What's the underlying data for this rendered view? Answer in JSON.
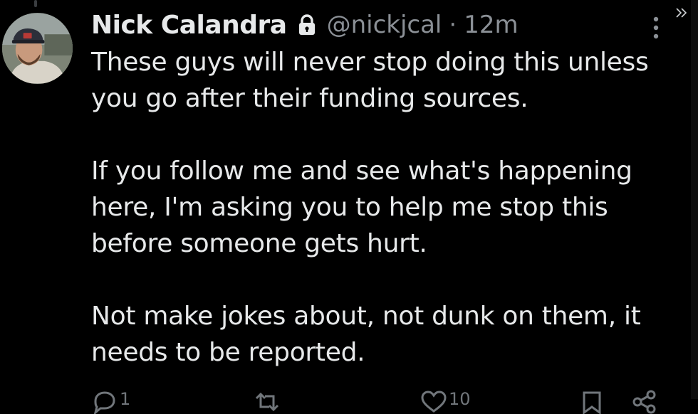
{
  "tweet": {
    "author": {
      "display_name": "Nick Calandra",
      "handle": "@nickjcal",
      "protected_icon": "lock-icon",
      "avatar_icon": "avatar-photo"
    },
    "separator": "·",
    "timestamp": "12m",
    "paragraphs": [
      "These guys will never stop doing this unless you go after their funding sources.",
      "If you follow me and see what's happening here, I'm asking you to help me stop this before someone gets hurt.",
      "Not make jokes about, not dunk on them, it needs to be reported."
    ],
    "actions": {
      "reply": {
        "icon": "reply-icon",
        "count": "1"
      },
      "retweet": {
        "icon": "retweet-icon",
        "count": ""
      },
      "like": {
        "icon": "heart-icon",
        "count": "10"
      },
      "bookmark": {
        "icon": "bookmark-icon",
        "count": ""
      },
      "share": {
        "icon": "share-icon",
        "count": ""
      }
    },
    "menu_icon": "more-options-icon",
    "expand_icon": "double-chevron-right-icon"
  },
  "colors": {
    "background": "#000000",
    "primary_text": "#e7e9ea",
    "secondary_text": "#8b9096",
    "action_icons": "#71767b"
  }
}
